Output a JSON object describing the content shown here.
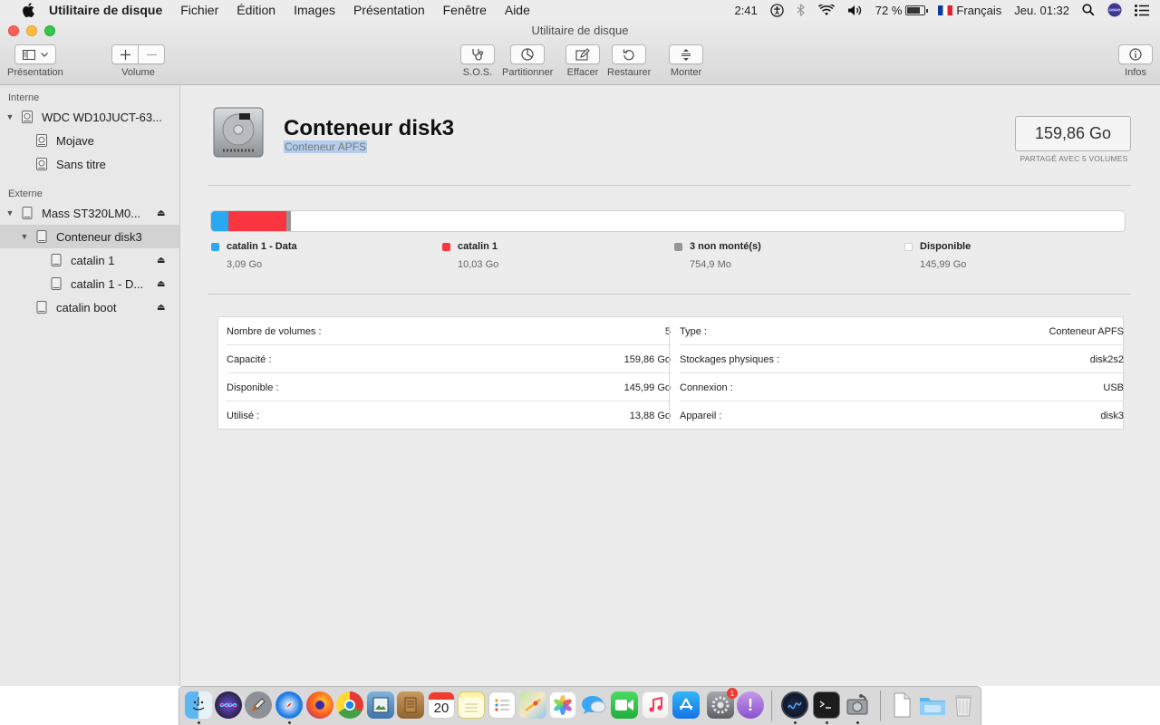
{
  "menubar": {
    "app_name": "Utilitaire de disque",
    "items": [
      "Fichier",
      "Édition",
      "Images",
      "Présentation",
      "Fenêtre",
      "Aide"
    ],
    "status": {
      "time": "2:41",
      "battery": "72 %",
      "language": "Français",
      "clock": "Jeu. 01:32"
    }
  },
  "window": {
    "title": "Utilitaire de disque",
    "toolbar": {
      "presentation": "Présentation",
      "volume": "Volume",
      "sos": "S.O.S.",
      "partition": "Partitionner",
      "erase": "Effacer",
      "restore": "Restaurer",
      "mount": "Monter",
      "info": "Infos"
    }
  },
  "sidebar": {
    "internal_header": "Interne",
    "external_header": "Externe",
    "internal": [
      {
        "label": "WDC WD10JUCT-63..."
      },
      {
        "label": "Mojave"
      },
      {
        "label": "Sans titre"
      }
    ],
    "external": [
      {
        "label": "Mass ST320LM0..."
      },
      {
        "label": "Conteneur disk3"
      },
      {
        "label": "catalin 1"
      },
      {
        "label": "catalin 1 - D..."
      },
      {
        "label": "catalin boot"
      }
    ]
  },
  "detail": {
    "title": "Conteneur disk3",
    "subtitle": "Conteneur APFS",
    "capacity": "159,86 Go",
    "capacity_note": "PARTAGÉ AVEC 5 VOLUMES",
    "usage": {
      "segments": [
        {
          "name": "catalin 1 - Data",
          "value": "3,09 Go",
          "fraction": 0.019,
          "color": "#28a9f1"
        },
        {
          "name": "catalin 1",
          "value": "10,03 Go",
          "fraction": 0.063,
          "color": "#f9363f"
        },
        {
          "name": "3 non monté(s)",
          "value": "754,9 Mo",
          "fraction": 0.005,
          "color": "#959595"
        },
        {
          "name": "Disponible",
          "value": "145,99 Go",
          "fraction": 0.913,
          "color": "#ffffff"
        }
      ]
    },
    "info_left": [
      {
        "key": "Nombre de volumes :",
        "value": "5"
      },
      {
        "key": "Capacité :",
        "value": "159,86 Go"
      },
      {
        "key": "Disponible :",
        "value": "145,99 Go"
      },
      {
        "key": "Utilisé :",
        "value": "13,88 Go"
      }
    ],
    "info_right": [
      {
        "key": "Type :",
        "value": "Conteneur APFS"
      },
      {
        "key": "Stockages physiques :",
        "value": "disk2s2"
      },
      {
        "key": "Connexion :",
        "value": "USB"
      },
      {
        "key": "Appareil :",
        "value": "disk3"
      }
    ]
  },
  "dock": {
    "calendar_day": "20",
    "system_prefs_badge": "1",
    "apps": [
      "finder-icon",
      "siri-icon",
      "launchpad-icon",
      "safari-icon",
      "firefox-icon",
      "chrome-icon",
      "preview-icon",
      "notefile-icon",
      "calendar-icon",
      "notes-icon",
      "reminders-icon",
      "maps-icon",
      "photos-icon",
      "messages-icon",
      "facetime-icon",
      "music-icon",
      "app-store-icon",
      "system-preferences-icon",
      "feedback-icon",
      "instruments-icon",
      "terminal-icon",
      "disk-utility-icon",
      "document-icon",
      "folder-icon",
      "trash-icon"
    ]
  }
}
